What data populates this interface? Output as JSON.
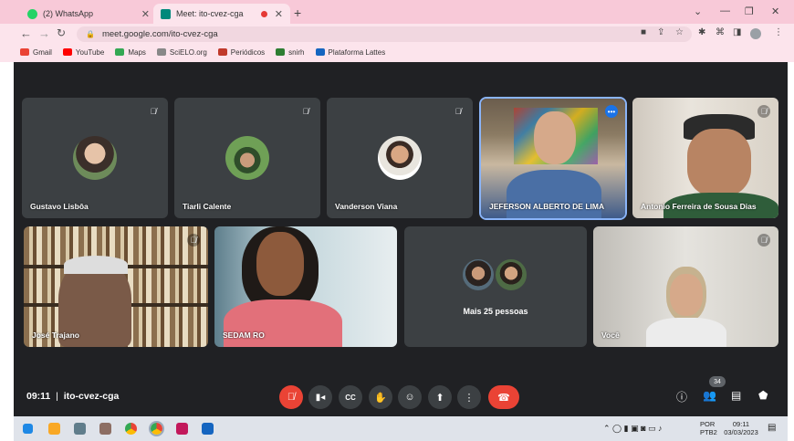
{
  "browser": {
    "tabs": [
      {
        "title": "(2) WhatsApp",
        "active": false
      },
      {
        "title": "Meet: ito-cvez-cga",
        "active": true
      }
    ],
    "new_tab": "+",
    "url": "meet.google.com/ito-cvez-cga",
    "bookmarks": [
      {
        "label": "Gmail",
        "icon": "gmail-icon",
        "color": "#ea4335"
      },
      {
        "label": "YouTube",
        "icon": "youtube-icon",
        "color": "#ff0000"
      },
      {
        "label": "Maps",
        "icon": "maps-icon",
        "color": "#34a853"
      },
      {
        "label": "SciELO.org",
        "icon": "scielo-icon",
        "color": "#555555"
      },
      {
        "label": "Periódicos",
        "icon": "periodicos-icon",
        "color": "#c0392b"
      },
      {
        "label": "snirh",
        "icon": "snirh-icon",
        "color": "#2e7d32"
      },
      {
        "label": "Plataforma Lattes",
        "icon": "lattes-icon",
        "color": "#1565c0"
      }
    ]
  },
  "meet": {
    "participants": [
      {
        "name": "Gustavo Lisbôa",
        "kind": "avatar",
        "muted": true,
        "color": "#6d8b5a"
      },
      {
        "name": "Tiarli Calente",
        "kind": "avatar",
        "muted": true,
        "color": "#4e7d3a"
      },
      {
        "name": "Vanderson Viana",
        "kind": "avatar",
        "muted": true,
        "color": "#c9c6bd"
      },
      {
        "name": "JEFERSON ALBERTO DE LIMA",
        "kind": "video",
        "muted": false,
        "speaking": true
      },
      {
        "name": "Antonio Ferreira de Sousa Dias",
        "kind": "video",
        "muted": true
      },
      {
        "name": "José Trajano",
        "kind": "video",
        "muted": true
      },
      {
        "name": "SEDAM RO",
        "kind": "video",
        "muted": false
      },
      {
        "name": "Mais 25 pessoas",
        "kind": "group",
        "muted": false
      },
      {
        "name": "Você",
        "kind": "video",
        "muted": true
      }
    ],
    "time": "09:11",
    "separator": "|",
    "meeting_code": "ito-cvez-cga",
    "participant_count": "34",
    "colors": {
      "end_call": "#ea4335",
      "mic_off": "#ea4335",
      "speaking_outline": "#8ab4f8"
    }
  },
  "taskbar": {
    "lang": "POR",
    "layout": "PTB2",
    "clock": "09:11",
    "date": "03/03/2023"
  }
}
